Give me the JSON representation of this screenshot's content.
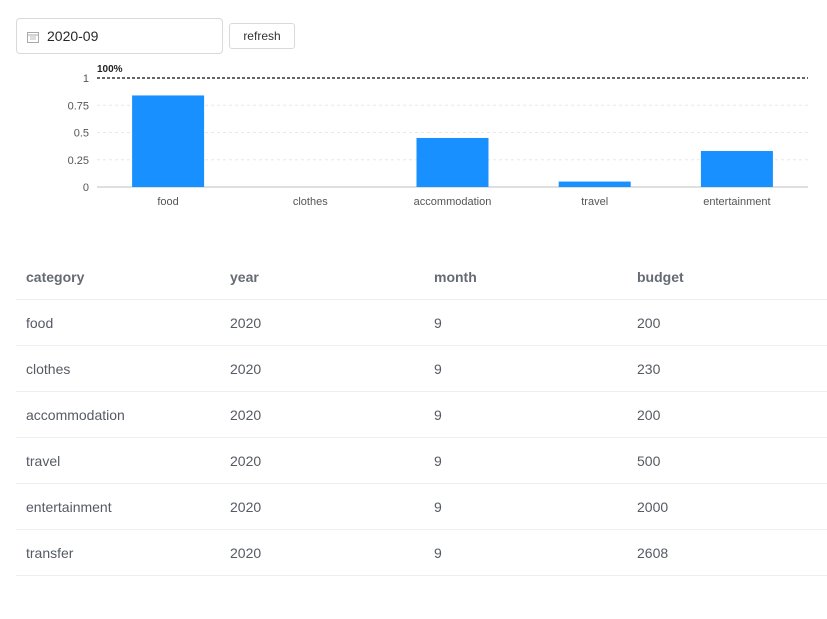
{
  "toolbar": {
    "date_value": "2020-09",
    "refresh_label": "refresh"
  },
  "chart_data": {
    "type": "bar",
    "categories": [
      "food",
      "clothes",
      "accommodation",
      "travel",
      "entertainment"
    ],
    "values": [
      0.84,
      0,
      0.45,
      0.05,
      0.33
    ],
    "ylim": [
      0,
      1
    ],
    "yticks": [
      "0",
      "0.25",
      "0.5",
      "0.75",
      "1"
    ],
    "reference_line": {
      "value": 1,
      "label": "100%"
    },
    "bar_color": "#1890ff",
    "grid": true
  },
  "table": {
    "headers": [
      "category",
      "year",
      "month",
      "budget"
    ],
    "rows": [
      [
        "food",
        "2020",
        "9",
        "200"
      ],
      [
        "clothes",
        "2020",
        "9",
        "230"
      ],
      [
        "accommodation",
        "2020",
        "9",
        "200"
      ],
      [
        "travel",
        "2020",
        "9",
        "500"
      ],
      [
        "entertainment",
        "2020",
        "9",
        "2000"
      ],
      [
        "transfer",
        "2020",
        "9",
        "2608"
      ]
    ]
  }
}
